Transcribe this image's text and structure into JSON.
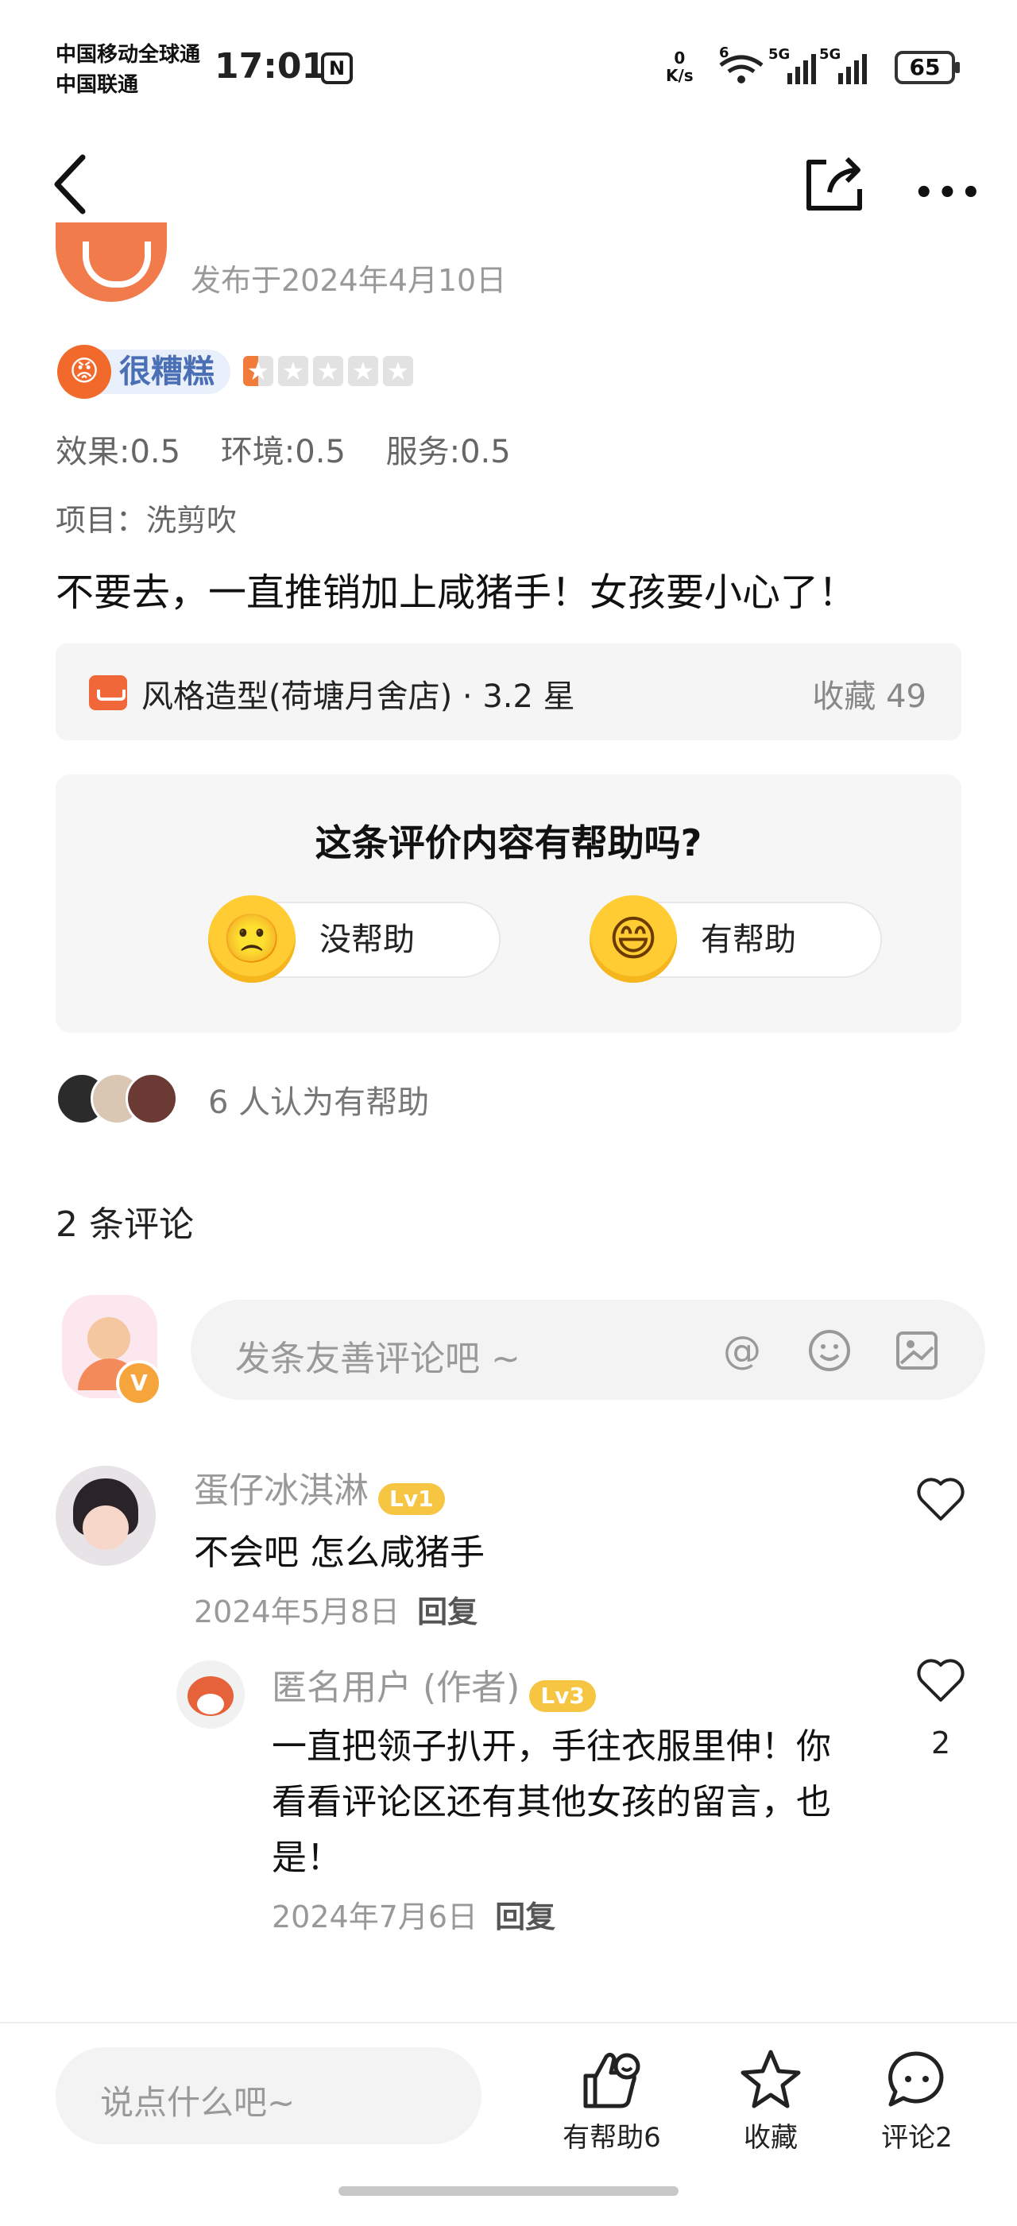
{
  "status_bar": {
    "carrier_1": "中国移动全球通",
    "carrier_2": "中国联通",
    "time": "17:01",
    "nfc": "N",
    "net_speed_value": "0",
    "net_speed_unit": "K/s",
    "wifi_tag": "6",
    "signal_1": "5G",
    "signal_2": "5G",
    "battery": "65"
  },
  "post": {
    "published": "发布于2024年4月10日",
    "rating_label": "很糟糕",
    "rating_stars": 0.5,
    "scores": [
      "效果:0.5",
      "环境:0.5",
      "服务:0.5"
    ],
    "project": "项目：洗剪吹",
    "review_text": "不要去，一直推销加上咸猪手！女孩要小心了！"
  },
  "shop": {
    "name": "风格造型(荷塘月舍店) · 3.2 星",
    "favorites": "收藏 49"
  },
  "helpful": {
    "question": "这条评价内容有帮助吗?",
    "no_label": "没帮助",
    "yes_label": "有帮助",
    "count_text": "6 人认为有帮助"
  },
  "comments": {
    "title": "2 条评论",
    "input_placeholder": "发条友善评论吧 ~",
    "my_badge": "V",
    "items": [
      {
        "name": "蛋仔冰淇淋",
        "level": "Lv1",
        "text": "不会吧 怎么咸猪手",
        "date": "2024年5月8日",
        "reply": "回复"
      },
      {
        "name": "匿名用户 (作者)",
        "level": "Lv3",
        "text_line1": "一直把领子扒开，手往衣服里伸！你",
        "text_line2": "看看评论区还有其他女孩的留言，也",
        "text_line3": "是！",
        "date": "2024年7月6日",
        "reply": "回复",
        "likes": "2"
      }
    ]
  },
  "bottom_bar": {
    "input_placeholder": "说点什么吧~",
    "helpful": "有帮助6",
    "favorite": "收藏",
    "comment": "评论2"
  }
}
